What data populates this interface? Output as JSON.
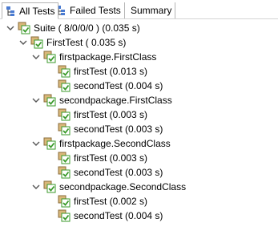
{
  "tabs": [
    {
      "label": "All Tests",
      "icon": "test-hierarchy-icon",
      "active": true
    },
    {
      "label": "Failed Tests",
      "icon": "test-hierarchy-icon",
      "active": false
    },
    {
      "label": "Summary",
      "icon": "",
      "active": false
    }
  ],
  "tree": {
    "suite": {
      "label": "Suite ( 8/0/0/0 ) (0.035 s)",
      "icon": "suite-passed-icon",
      "expanded": true
    },
    "test": {
      "label": "FirstTest ( 0.035 s)",
      "icon": "test-passed-icon",
      "expanded": true
    },
    "classes": [
      {
        "label": "firstpackage.FirstClass",
        "expanded": true,
        "methods": [
          {
            "label": "firstTest  (0.013 s)"
          },
          {
            "label": "secondTest  (0.004 s)"
          }
        ]
      },
      {
        "label": "secondpackage.FirstClass",
        "expanded": true,
        "methods": [
          {
            "label": "firstTest  (0.003 s)"
          },
          {
            "label": "secondTest  (0.003 s)"
          }
        ]
      },
      {
        "label": "firstpackage.SecondClass",
        "expanded": true,
        "methods": [
          {
            "label": "firstTest  (0.003 s)"
          },
          {
            "label": "secondTest  (0.003 s)"
          }
        ]
      },
      {
        "label": "secondpackage.SecondClass",
        "expanded": true,
        "methods": [
          {
            "label": "firstTest  (0.002 s)"
          },
          {
            "label": "secondTest  (0.004 s)"
          }
        ]
      }
    ]
  },
  "colors": {
    "pass_green": "#3a9a2a",
    "icon_tan": "#d9b87a",
    "chevron": "#555555"
  }
}
